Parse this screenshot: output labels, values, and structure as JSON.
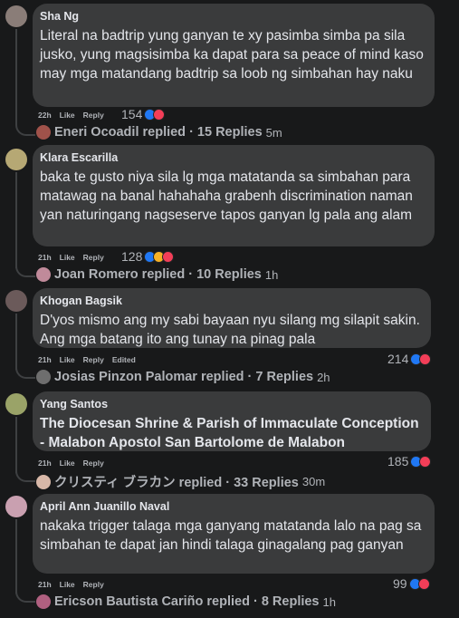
{
  "comments": [
    {
      "author": "Sha Ng",
      "text": "Literal na badtrip yung ganyan te xy pasimba simba pa sila jusko, yung magsisimba ka dapat para sa peace of mind kaso may mga matandang badtrip sa loob ng simbahan hay naku",
      "time": "22h",
      "like": "Like",
      "reply": "Reply",
      "edited": "",
      "reactions": "154",
      "replies_text": "Eneri Ocoadil replied · 15 Replies",
      "replies_ago": "5m",
      "avatar_color": "#8a7d78",
      "reply_avatar_color": "#a0524a"
    },
    {
      "author": "Klara Escarilla",
      "text": "baka te gusto niya sila lg mga matatanda sa simbahan para matawag na banal hahahaha grabenh discrimination naman yan naturingang nagseserve tapos ganyan lg pala ang alam",
      "time": "21h",
      "like": "Like",
      "reply": "Reply",
      "edited": "",
      "reactions": "128",
      "replies_text": "Joan Romero replied · 10 Replies",
      "replies_ago": "1h",
      "avatar_color": "#b6a874",
      "reply_avatar_color": "#c08a9a"
    },
    {
      "author": "Khogan Bagsik",
      "text": "D'yos mismo ang my sabi bayaan nyu silang mg silapit sakin. Ang mga batang ito ang tunay na pinag pala",
      "time": "21h",
      "like": "Like",
      "reply": "Reply",
      "edited": "Edited",
      "reactions": "214",
      "replies_text": "Josias Pinzon Palomar replied · 7 Replies",
      "replies_ago": "2h",
      "avatar_color": "#6b5a5a",
      "reply_avatar_color": "#6e6e6e"
    },
    {
      "author": "Yang Santos",
      "text": "The Diocesan Shrine & Parish of Immaculate Conception - Malabon Apostol San Bartolome de Malabon",
      "time": "21h",
      "like": "Like",
      "reply": "Reply",
      "edited": "",
      "reactions": "185",
      "replies_text": "クリスティ ブラカン replied · 33 Replies",
      "replies_ago": "30m",
      "avatar_color": "#9aa368",
      "reply_avatar_color": "#d8b8a8"
    },
    {
      "author": "April Ann Juanillo Naval",
      "text": "nakaka trigger talaga mga ganyang matatanda lalo na pag sa simbahan te dapat jan hindi talaga ginagalang pag ganyan",
      "time": "21h",
      "like": "Like",
      "reply": "Reply",
      "edited": "",
      "reactions": "99",
      "replies_text": "Ericson Bautista Cariño replied · 8 Replies",
      "replies_ago": "1h",
      "avatar_color": "#c9a0b0",
      "reply_avatar_color": "#b06080"
    }
  ]
}
